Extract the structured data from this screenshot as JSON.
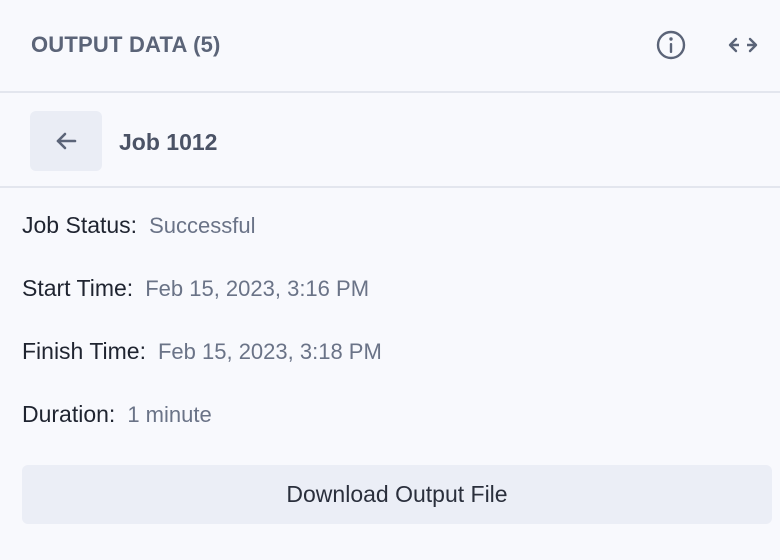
{
  "header": {
    "title": "OUTPUT DATA (5)",
    "info_icon": "info-circle-icon",
    "expand_icon": "horizontal-arrows-icon"
  },
  "job": {
    "back_icon": "arrow-left-icon",
    "title": "Job 1012"
  },
  "details": {
    "status": {
      "label": "Job Status:",
      "value": "Successful"
    },
    "start": {
      "label": "Start Time:",
      "value": "Feb 15, 2023, 3:16 PM"
    },
    "finish": {
      "label": "Finish Time:",
      "value": "Feb 15, 2023, 3:18 PM"
    },
    "duration": {
      "label": "Duration:",
      "value": "1 minute"
    }
  },
  "actions": {
    "download_label": "Download Output File"
  },
  "colors": {
    "background": "#f8f9fd",
    "muted_text": "#6a7387",
    "button_bg": "#ebeef6",
    "divider": "#e3e6ee"
  }
}
